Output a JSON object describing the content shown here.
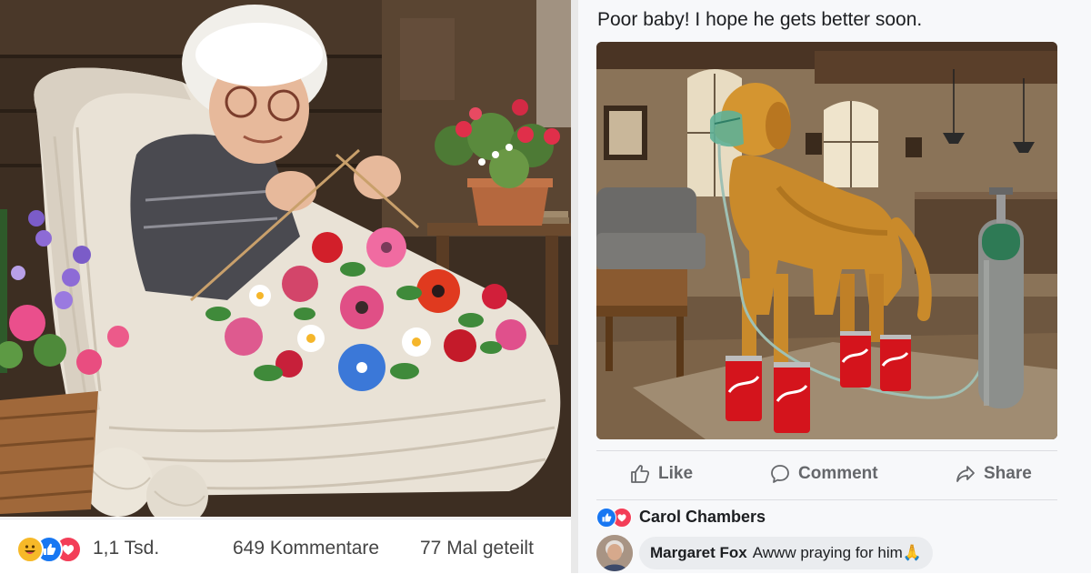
{
  "left_post": {
    "photo_description_icon": "grandma-knitting-photo",
    "reaction_icons": [
      "haha-icon",
      "like-icon",
      "love-icon"
    ],
    "reaction_count": "1,1 Tsd.",
    "comments_count": "649 Kommentare",
    "shares_count": "77 Mal geteilt"
  },
  "right_post": {
    "caption": "Poor baby! I hope he gets better soon.",
    "photo_description_icon": "dog-oxygen-mask-photo",
    "actions": {
      "like": "Like",
      "comment": "Comment",
      "share": "Share"
    },
    "reactor": {
      "icons": [
        "like-icon",
        "love-icon"
      ],
      "name": "Carol Chambers"
    },
    "comment": {
      "author": "Margaret Fox",
      "text": "Awww praying for him🙏"
    }
  },
  "colors": {
    "like_blue": "#1877f2",
    "love_red": "#f33e58",
    "haha_yellow": "#f7b928",
    "secondary_text": "#65676b"
  }
}
